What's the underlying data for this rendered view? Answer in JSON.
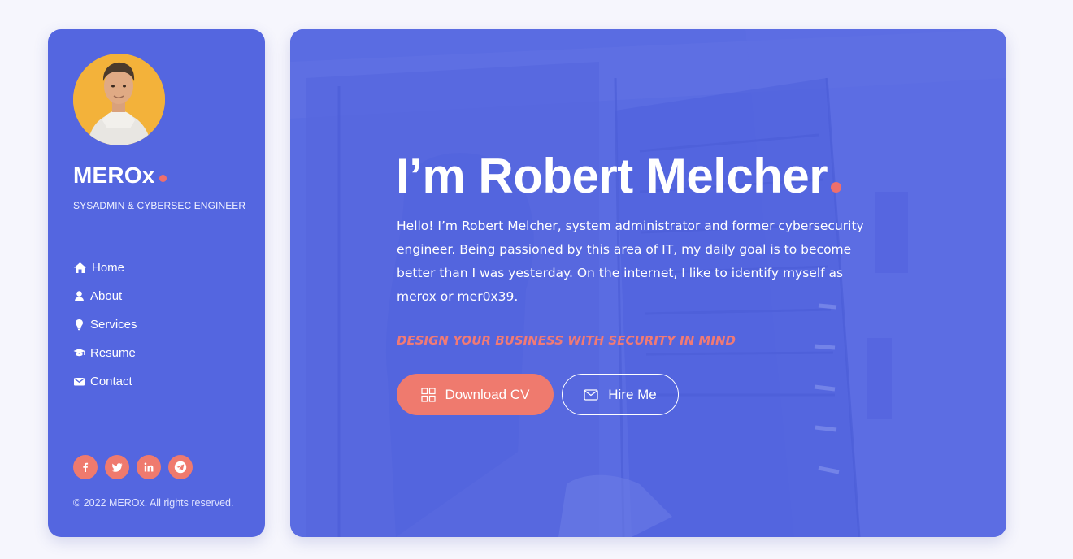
{
  "sidebar": {
    "brand": "MEROx",
    "tagline": "SYSADMIN & CYBERSEC ENGINEER",
    "nav": [
      {
        "label": "Home",
        "icon": "home-icon"
      },
      {
        "label": "About",
        "icon": "user-icon"
      },
      {
        "label": "Services",
        "icon": "lightbulb-icon"
      },
      {
        "label": "Resume",
        "icon": "graduation-cap-icon"
      },
      {
        "label": "Contact",
        "icon": "envelope-icon"
      }
    ],
    "socials": [
      {
        "name": "facebook",
        "glyph": "f"
      },
      {
        "name": "twitter",
        "glyph": "t"
      },
      {
        "name": "linkedin",
        "glyph": "in"
      },
      {
        "name": "telegram",
        "glyph": "tg"
      }
    ],
    "copyright": "© 2022 MEROx. All rights reserved."
  },
  "hero": {
    "title": "I’m Robert Melcher",
    "intro": "Hello! I’m Robert Melcher, system administrator and former cybersecurity engineer. Being passioned by this area of IT, my daily goal is to become better than I was yesterday. On the internet, I like to identify myself as merox or mer0x39.",
    "accent": "DESIGN YOUR BUSINESS WITH SECURITY IN MIND",
    "buttons": {
      "download_cv": "Download CV",
      "hire_me": "Hire Me"
    }
  },
  "colors": {
    "sidebar_bg": "#5466e0",
    "hero_bg": "#5a6ce2",
    "accent": "#ef6f6c",
    "page_bg": "#f6f6fd",
    "avatar_bg": "#f3b23a"
  }
}
